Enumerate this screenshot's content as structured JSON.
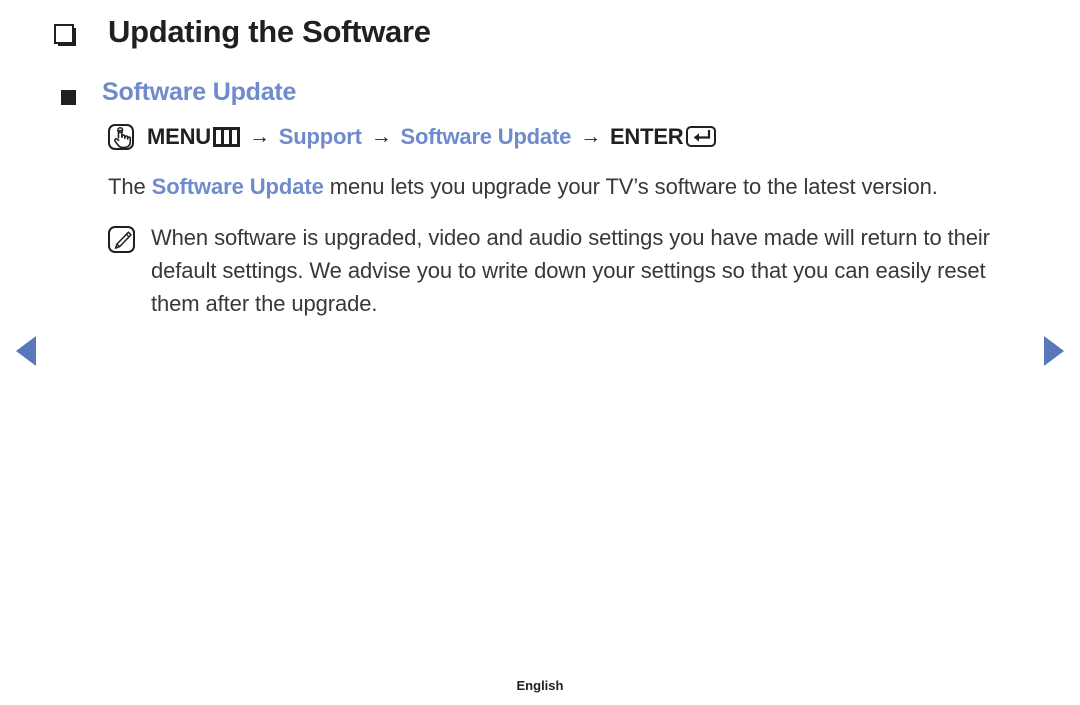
{
  "page": {
    "heading": "Updating the Software",
    "section_heading": "Software Update",
    "footer_language": "English"
  },
  "icons": {
    "h1_bullet": "hollow-square-bullet-icon",
    "h2_bullet": "filled-square-bullet-icon",
    "touch": "hand-press-button-icon",
    "menu_bars": "menu-bars-icon",
    "enter_key": "enter-return-key-icon",
    "note": "note-pencil-icon",
    "prev": "prev-page-arrow-icon",
    "next": "next-page-arrow-icon"
  },
  "menu_path": {
    "item1": "MENU",
    "arrow": "→",
    "item2": "Support",
    "item3": "Software Update",
    "item4": "ENTER"
  },
  "body": {
    "para_part1": "The ",
    "para_highlight": "Software Update",
    "para_part2": " menu lets you upgrade your TV’s software to the latest version."
  },
  "note": {
    "text": "When software is upgraded, video and audio settings you have made will return to their default settings. We advise you to write down your settings so that you can easily reset them after the upgrade."
  },
  "colors": {
    "accent_blue": "#6f8bcc",
    "nav_blue": "#5878bc",
    "text_dark": "#231f20",
    "body_text": "#3b3738"
  }
}
